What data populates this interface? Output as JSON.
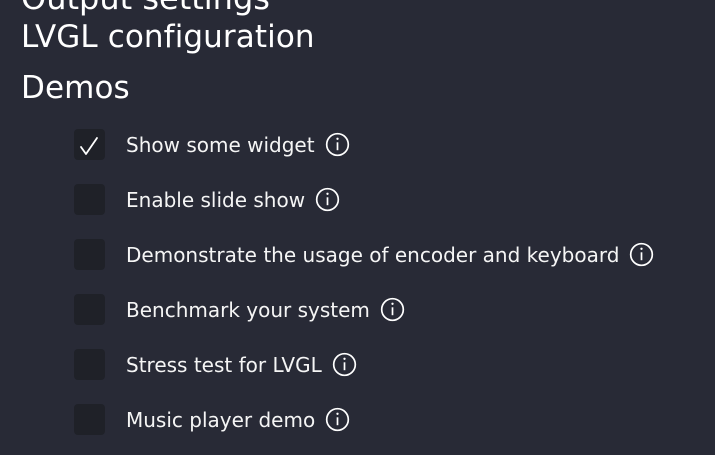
{
  "sections": {
    "cut_heading": "Output settings",
    "configuration_heading": "LVGL configuration",
    "demos_heading": "Demos"
  },
  "demos": [
    {
      "label": "Show some widget",
      "checked": true,
      "icon": "info-icon"
    },
    {
      "label": "Enable slide show",
      "checked": false,
      "icon": "info-icon"
    },
    {
      "label": "Demonstrate the usage of encoder and keyboard",
      "checked": false,
      "icon": "info-icon"
    },
    {
      "label": "Benchmark your system",
      "checked": false,
      "icon": "info-icon"
    },
    {
      "label": "Stress test for LVGL",
      "checked": false,
      "icon": "info-icon"
    },
    {
      "label": "Music player demo",
      "checked": false,
      "icon": "info-icon"
    }
  ],
  "colors": {
    "background": "#282a36",
    "checkbox_background": "#1f2128",
    "text": "#ffffff"
  }
}
